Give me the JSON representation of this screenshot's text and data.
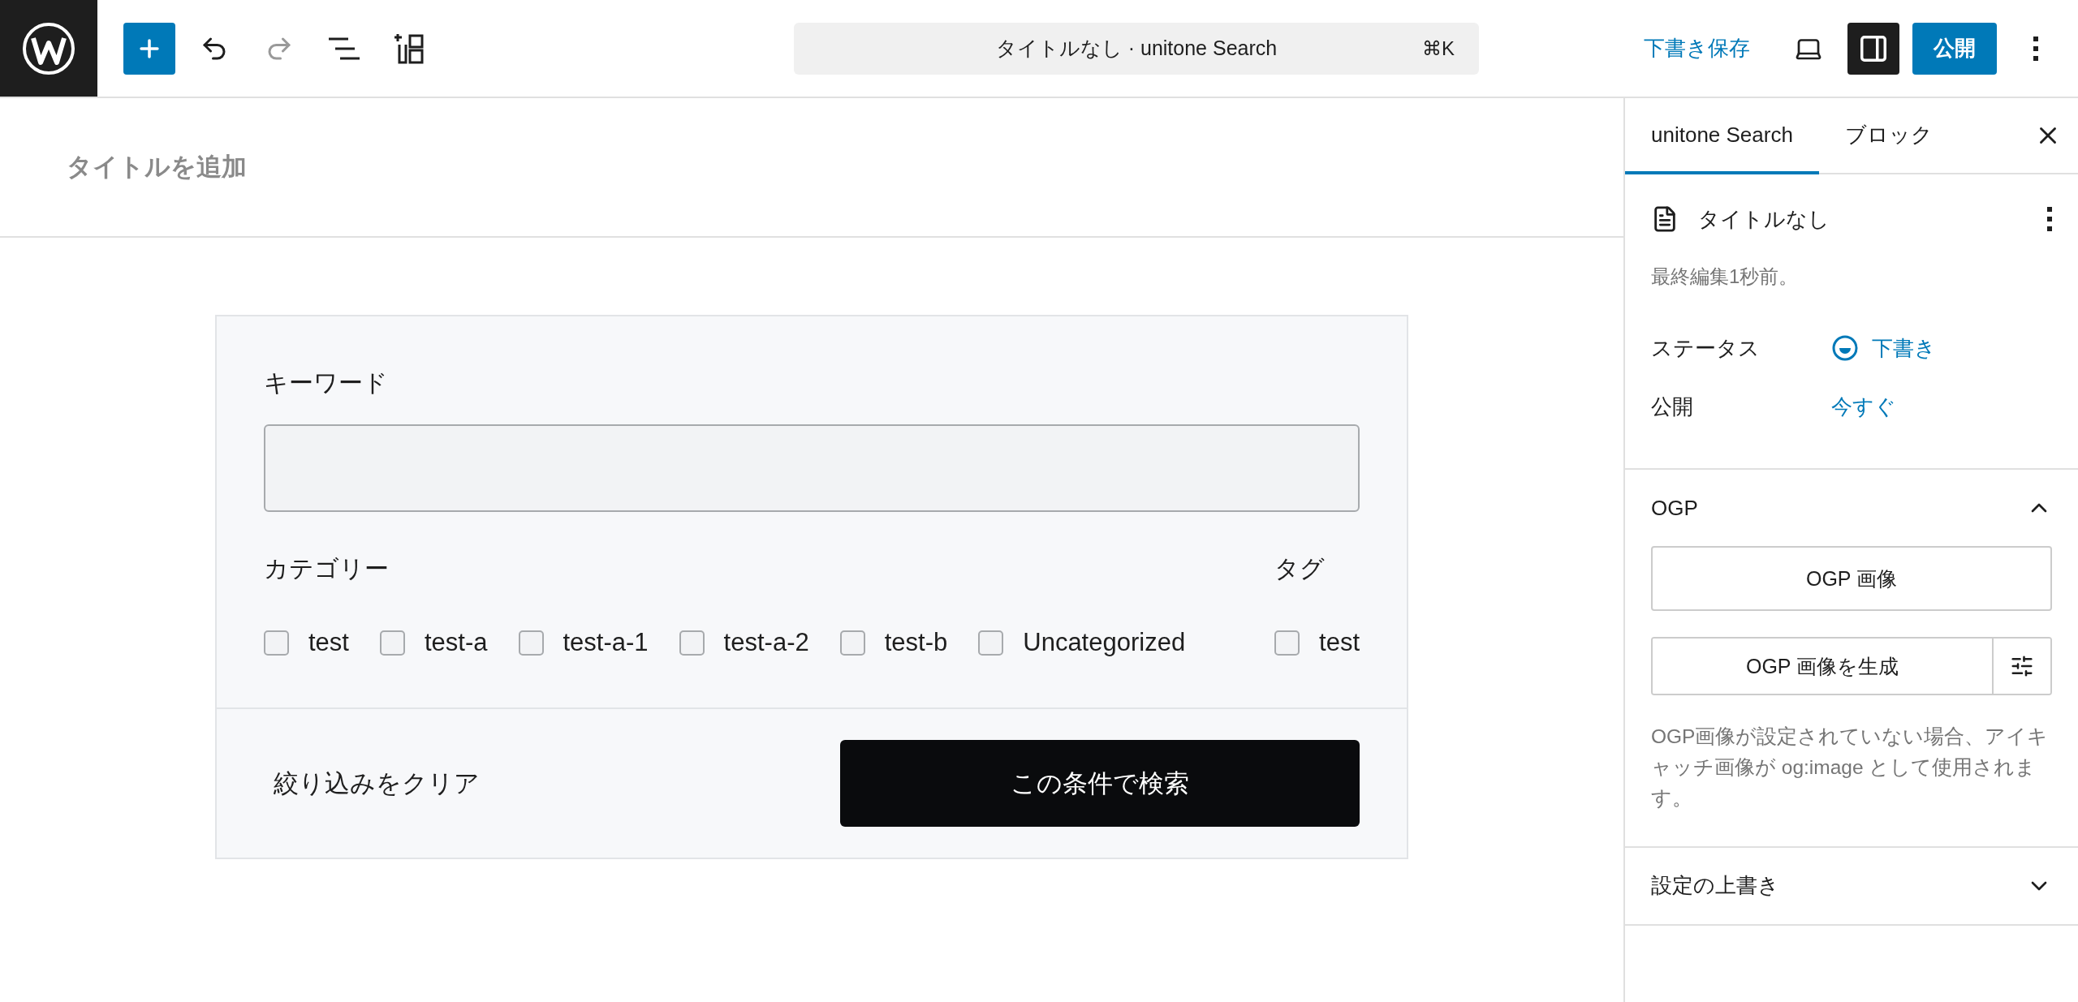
{
  "toolbar": {
    "tools": [
      {
        "kind": "add",
        "disabled": false
      },
      {
        "kind": "undo",
        "disabled": false
      },
      {
        "kind": "redo",
        "disabled": true
      },
      {
        "kind": "list",
        "disabled": false
      },
      {
        "kind": "patterns",
        "disabled": false
      }
    ],
    "command": {
      "title": "タイトルなし · unitone Search",
      "shortcut": "⌘K"
    },
    "save_draft": "下書き保存",
    "settings_open": true,
    "publish": "公開"
  },
  "editor": {
    "title_placeholder": "タイトルを追加",
    "search_block": {
      "keyword_label": "キーワード",
      "category_label": "カテゴリー",
      "categories": [
        {
          "label": "test",
          "checked": false
        },
        {
          "label": "test-a",
          "checked": false
        },
        {
          "label": "test-a-1",
          "checked": false
        },
        {
          "label": "test-a-2",
          "checked": false
        },
        {
          "label": "test-b",
          "checked": false
        },
        {
          "label": "Uncategorized",
          "checked": false
        }
      ],
      "tag_label": "タグ",
      "tags": [
        {
          "label": "test",
          "checked": false
        }
      ],
      "clear": "絞り込みをクリア",
      "submit": "この条件で検索"
    }
  },
  "sidebar": {
    "tabs": [
      {
        "label": "unitone Search",
        "selected": true
      },
      {
        "label": "ブロック",
        "selected": false
      }
    ],
    "post_title": "タイトルなし",
    "last_edited": "最終編集1秒前。",
    "rows": [
      {
        "label": "ステータス",
        "value": "下書き",
        "kind": "status"
      },
      {
        "label": "公開",
        "value": "今すぐ",
        "kind": "plain"
      }
    ],
    "panels": [
      {
        "title": "OGP",
        "expanded": true,
        "image_button": "OGP 画像",
        "generate_button": "OGP 画像を生成",
        "description": "OGP画像が設定されていない場合、アイキャッチ画像が og:image として使用されます。"
      },
      {
        "title": "設定の上書き",
        "expanded": false
      }
    ]
  }
}
